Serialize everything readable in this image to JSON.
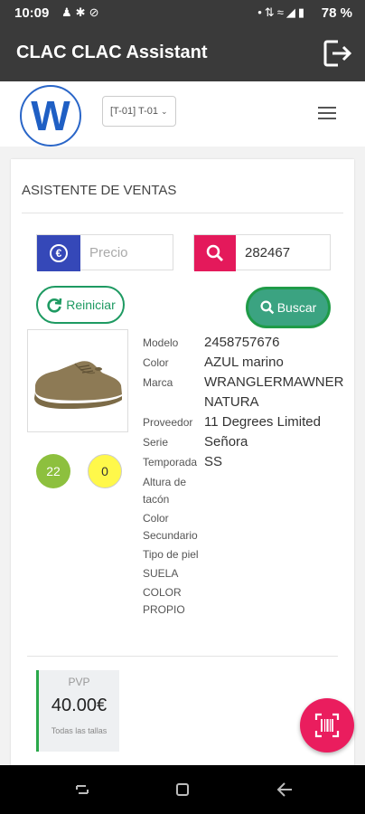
{
  "status_bar": {
    "time": "10:09",
    "left_icons": [
      "person-icon",
      "notification-icon",
      "blocked-icon"
    ],
    "right_icons": [
      "dot-icon",
      "bluetooth-icon",
      "wifi-icon",
      "signal-icon",
      "battery-icon"
    ],
    "battery": "78 %"
  },
  "app_bar": {
    "title": "CLAC CLAC Assistant",
    "logout_icon": "logout-icon"
  },
  "top_nav": {
    "logo_letter": "W",
    "store_selector": "[T-01] T-01",
    "menu_icon": "hamburger-icon"
  },
  "sales": {
    "title": "ASISTENTE DE VENTAS",
    "price": {
      "placeholder": "Precio",
      "value": "",
      "icon": "euro-icon"
    },
    "code": {
      "value": "282467",
      "icon": "search-icon"
    },
    "reset_label": "Reiniciar",
    "search_label": "Buscar"
  },
  "product": {
    "image": "shoe-image",
    "stock_badge": "22",
    "pending_badge": "0",
    "attributes": [
      {
        "label": "Modelo",
        "value": "2458757676"
      },
      {
        "label": "Color",
        "value": "AZUL marino"
      },
      {
        "label": "Marca",
        "value": "WRANGLERMAWNER NATURA"
      },
      {
        "label": "Proveedor",
        "value": "11 Degrees Limited"
      },
      {
        "label": "Serie",
        "value": "Señora"
      },
      {
        "label": "Temporada",
        "value": "SS"
      },
      {
        "label": "Altura de tacón",
        "value": ""
      },
      {
        "label": "Color Secundario",
        "value": ""
      },
      {
        "label": "Tipo de piel",
        "value": ""
      },
      {
        "label": "SUELA",
        "value": ""
      },
      {
        "label": "COLOR PROPIO",
        "value": ""
      }
    ],
    "pvp": {
      "label": "PVP",
      "amount": "40.00€",
      "note": "Todas las tallas"
    }
  },
  "fab_icon": "barcode-scan-icon",
  "nav_bar": {
    "icons": [
      "recent-apps-icon",
      "home-icon",
      "back-icon"
    ]
  },
  "colors": {
    "app_bar": "#3a3a3a",
    "euro_addon": "#3548b8",
    "search_addon": "#e4195b",
    "reset_green": "#1e9a62",
    "search_button": "#3ba381",
    "stock_badge": "#8dc03e",
    "pending_badge": "#fff84a",
    "fab": "#ea1d5e"
  }
}
